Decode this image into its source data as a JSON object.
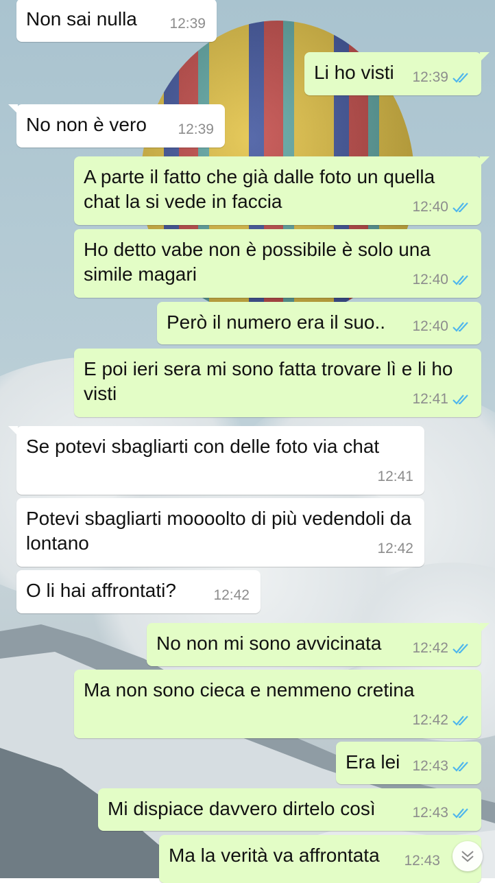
{
  "messages": [
    {
      "dir": "in",
      "text": "Non sai nulla",
      "time": "12:39"
    },
    {
      "dir": "out",
      "text": "Li ho visti",
      "time": "12:39"
    },
    {
      "dir": "in",
      "text": "No non è vero",
      "time": "12:39"
    },
    {
      "dir": "out",
      "text": "A parte il fatto che già dalle foto un quella chat la si vede in faccia",
      "time": "12:40"
    },
    {
      "dir": "out",
      "text": "Ho detto vabe non è possibile è solo una simile magari",
      "time": "12:40"
    },
    {
      "dir": "out",
      "text": "Però il numero era il suo..",
      "time": "12:40"
    },
    {
      "dir": "out",
      "text": "E poi ieri sera mi sono fatta trovare lì e li ho visti",
      "time": "12:41"
    },
    {
      "dir": "in",
      "text": "Se potevi sbagliarti con delle foto via chat",
      "time": "12:41"
    },
    {
      "dir": "in",
      "text": "Potevi sbagliarti moooolto di più vedendoli da lontano",
      "time": "12:42"
    },
    {
      "dir": "in",
      "text": "O li hai affrontati?",
      "time": "12:42"
    },
    {
      "dir": "out",
      "text": "No non mi sono avvicinata",
      "time": "12:42"
    },
    {
      "dir": "out",
      "text": "Ma non sono cieca e nemmeno cretina",
      "time": "12:42"
    },
    {
      "dir": "out",
      "text": "Era lei",
      "time": "12:43"
    },
    {
      "dir": "out",
      "text": "Mi dispiace davvero dirtelo così",
      "time": "12:43"
    },
    {
      "dir": "out",
      "text": "Ma la verità va affrontata",
      "time": "12:43"
    }
  ],
  "icons": {
    "read_receipt": "double-check-icon",
    "scroll_down": "chevron-double-down-icon"
  },
  "colors": {
    "incoming_bubble": "#ffffff",
    "outgoing_bubble": "#e3fdc6",
    "read_tick": "#4fb6ec",
    "timestamp": "#8c8c8c"
  }
}
